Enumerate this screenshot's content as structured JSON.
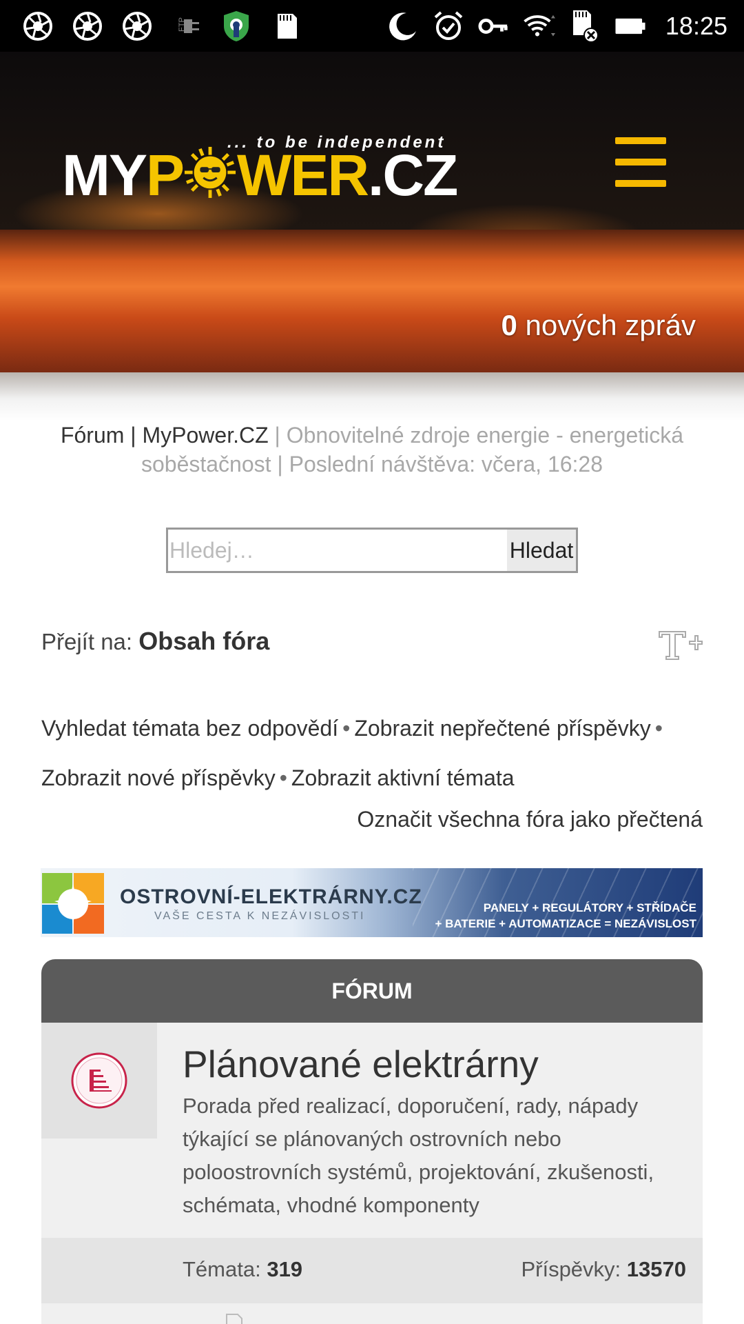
{
  "status_bar": {
    "time": "18:25",
    "icons": [
      "aperture-icon",
      "aperture-icon",
      "aperture-icon",
      "ftp-icon",
      "vpn-shield-icon",
      "sd-card-icon",
      "moon-icon",
      "alarm-icon",
      "key-icon",
      "wifi-icon",
      "sd-card-error-icon",
      "battery-icon"
    ]
  },
  "header": {
    "logo_tagline": "... to be independent",
    "logo_part1": "MY",
    "logo_part2": "P",
    "logo_part3": "WER",
    "logo_part4": ".CZ",
    "new_messages_count": "0",
    "new_messages_label": " nových zpráv",
    "menu_icon": "hamburger-icon",
    "accent_color": "#f5b800"
  },
  "breadcrumb": {
    "forum": "Fórum | MyPower.CZ",
    "rest": " | Obnovitelné zdroje energie - energetická soběstačnost | Poslední návštěva: včera, 16:28"
  },
  "search": {
    "placeholder": "Hledej…",
    "button_label": "Hledat"
  },
  "jump": {
    "label": "Přejít na: ",
    "target": "Obsah fóra",
    "font_size_icon": "font-size-icon"
  },
  "quick_links": {
    "unanswered": "Vyhledat témata bez odpovědí",
    "unread": "Zobrazit nepřečtené příspěvky",
    "new_posts": "Zobrazit nové příspěvky",
    "active_topics": "Zobrazit aktivní témata",
    "separator": "•",
    "mark_all_read": "Označit všechna fóra jako přečtená"
  },
  "banner": {
    "site_name": "OSTROVNÍ-ELEKTRÁRNY.CZ",
    "slogan": "VAŠE CESTA K NEZÁVISLOSTI",
    "line1": "PANELY + REGULÁTORY + STŘÍDAČE",
    "line2": "+ BATERIE + AUTOMATIZACE = NEZÁVISLOST"
  },
  "forum": {
    "header": "FÓRUM",
    "rows": [
      {
        "title": "Plánované elektrárny",
        "description": "Porada před realizací, doporučení, rady, nápady týkající se plánovaných ostrovních nebo poloostrovních systémů, projektování, zkušenosti, schémata, vhodné komponenty",
        "topics_label": "Témata: ",
        "topics": "319",
        "posts_label": "Příspěvky: ",
        "posts": "13570",
        "icon": "forum-unread-icon",
        "icon_color": "#c8234a"
      }
    ]
  }
}
